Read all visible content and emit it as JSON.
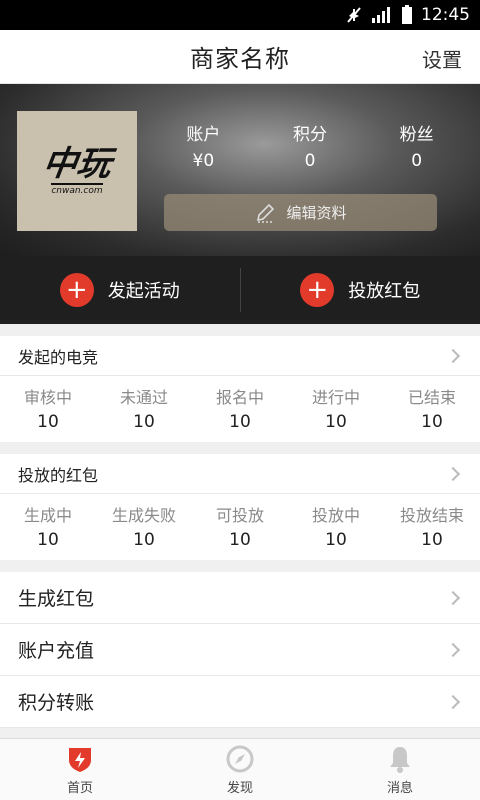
{
  "status_bar": {
    "time": "12:45"
  },
  "header": {
    "title": "商家名称",
    "settings_label": "设置"
  },
  "profile": {
    "logo": {
      "main": "中玩",
      "sub": "cnwan.com"
    },
    "stats": [
      {
        "label": "账户",
        "value": "¥0"
      },
      {
        "label": "积分",
        "value": "0"
      },
      {
        "label": "粉丝",
        "value": "0"
      }
    ],
    "edit_label": "编辑资料"
  },
  "actions": [
    {
      "label": "发起活动"
    },
    {
      "label": "投放红包"
    }
  ],
  "esports": {
    "title": "发起的电竞",
    "items": [
      {
        "label": "审核中",
        "value": "10"
      },
      {
        "label": "未通过",
        "value": "10"
      },
      {
        "label": "报名中",
        "value": "10"
      },
      {
        "label": "进行中",
        "value": "10"
      },
      {
        "label": "已结束",
        "value": "10"
      }
    ]
  },
  "redpackets": {
    "title": "投放的红包",
    "items": [
      {
        "label": "生成中",
        "value": "10"
      },
      {
        "label": "生成失败",
        "value": "10"
      },
      {
        "label": "可投放",
        "value": "10"
      },
      {
        "label": "投放中",
        "value": "10"
      },
      {
        "label": "投放结束",
        "value": "10"
      }
    ]
  },
  "menu": [
    {
      "label": "生成红包"
    },
    {
      "label": "账户充值"
    },
    {
      "label": "积分转账"
    }
  ],
  "bottom_nav": [
    {
      "label": "首页",
      "icon": "home-shield-icon",
      "color": "#e23b2b"
    },
    {
      "label": "发现",
      "icon": "compass-icon",
      "color": "#c8c8c8"
    },
    {
      "label": "消息",
      "icon": "bell-icon",
      "color": "#c8c8c8"
    }
  ],
  "colors": {
    "accent": "#e23b2b",
    "dark_bar": "#1f1f1f"
  }
}
